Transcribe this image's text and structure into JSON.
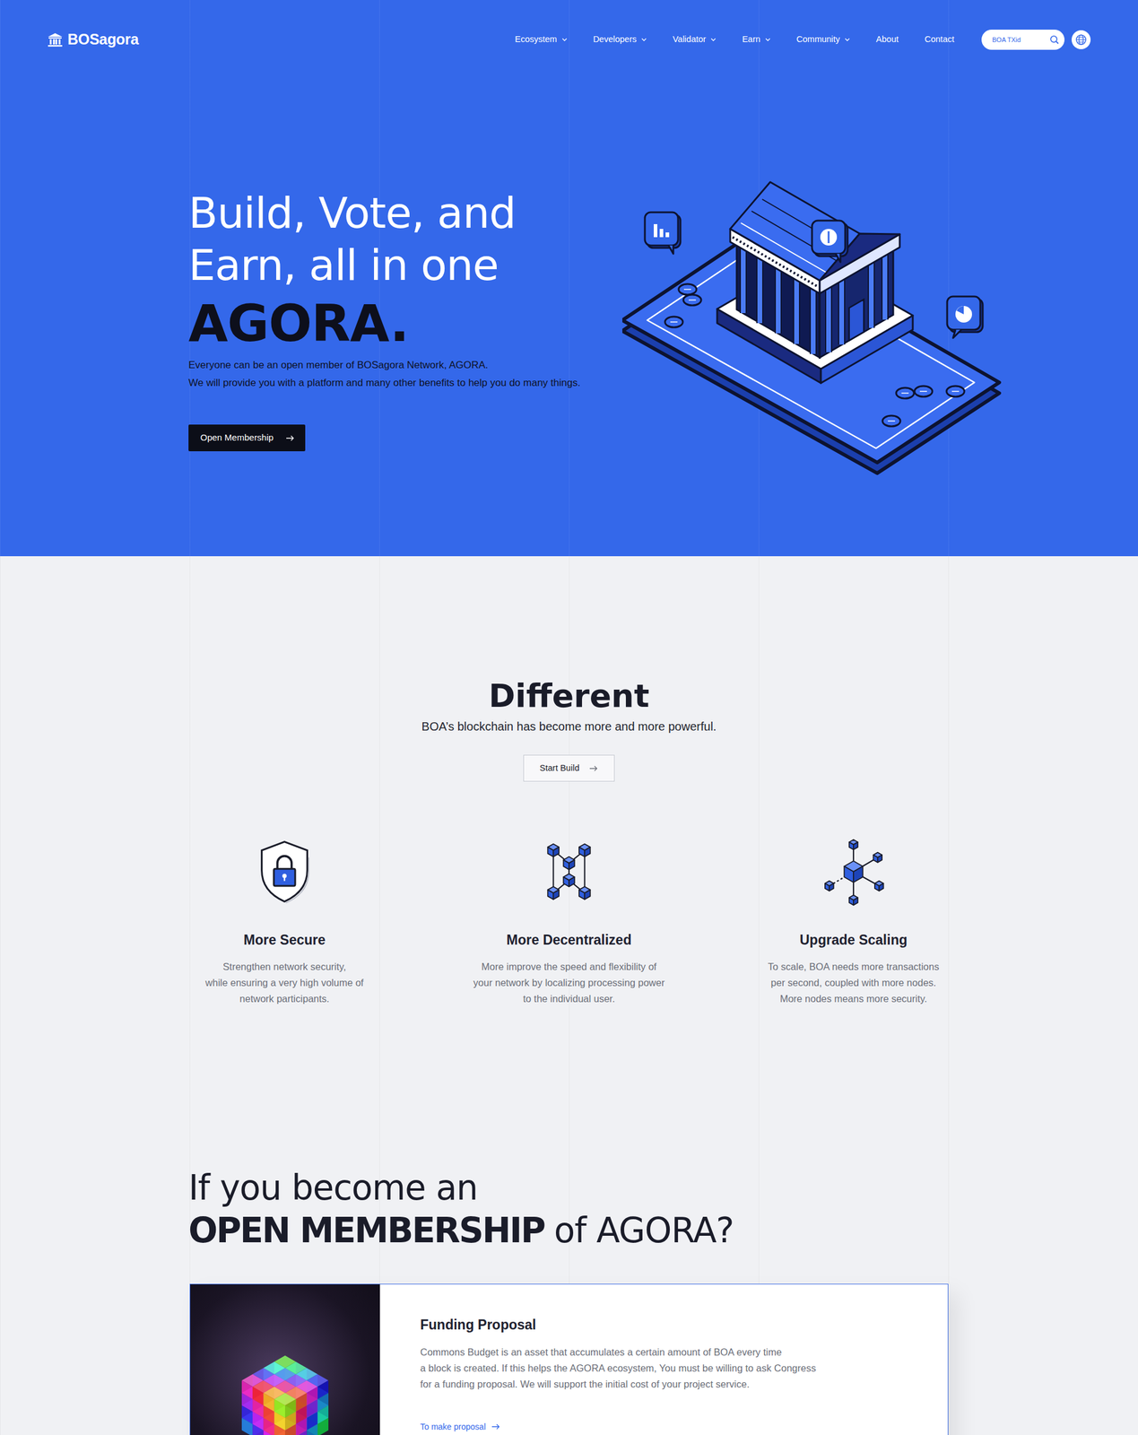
{
  "brand": {
    "name": "BOSagora"
  },
  "nav": {
    "items": [
      {
        "label": "Ecosystem",
        "has_menu": true
      },
      {
        "label": "Developers",
        "has_menu": true
      },
      {
        "label": "Validator",
        "has_menu": true
      },
      {
        "label": "Earn",
        "has_menu": true
      },
      {
        "label": "Community",
        "has_menu": true
      },
      {
        "label": "About",
        "has_menu": false
      },
      {
        "label": "Contact",
        "has_menu": false
      }
    ]
  },
  "search": {
    "placeholder": "BOA TXid"
  },
  "hero": {
    "title_lines": [
      "Build, Vote, and",
      "Earn, all in one"
    ],
    "title_emphasis": "AGORA.",
    "description_lines": [
      "Everyone can be an open member of BOSagora Network, AGORA.",
      "We will provide you with a platform and many other benefits to help you do many things."
    ],
    "button": "Open Membership"
  },
  "different": {
    "title": "Different",
    "subtitle": "BOA’s blockchain has become more and more powerful.",
    "button": "Start Build",
    "features": [
      {
        "title": "More Secure",
        "lines": [
          "Strengthen network security,",
          "while ensuring a very high volume of",
          "network participants."
        ]
      },
      {
        "title": "More Decentralized",
        "lines": [
          "More improve the speed and flexibility of",
          "your network by localizing processing power",
          "to the individual user."
        ]
      },
      {
        "title": "Upgrade Scaling",
        "lines": [
          "To scale, BOA needs more transactions",
          "per second, coupled with more nodes.",
          "More nodes means more security."
        ]
      }
    ]
  },
  "membership": {
    "title_line": "If you become an",
    "title_bold": "OPEN MEMBERSHIP",
    "title_rest": "of AGORA?",
    "cards": [
      {
        "title": "Funding Proposal",
        "description_lines": [
          "Commons Budget is an asset that accumulates a certain amount of BOA every time",
          "a block is created. If this helps the AGORA ecosystem, You must be willing to ask Congress",
          "for a funding proposal. We will support the initial cost of your project service."
        ],
        "link": "To make proposal"
      }
    ]
  }
}
